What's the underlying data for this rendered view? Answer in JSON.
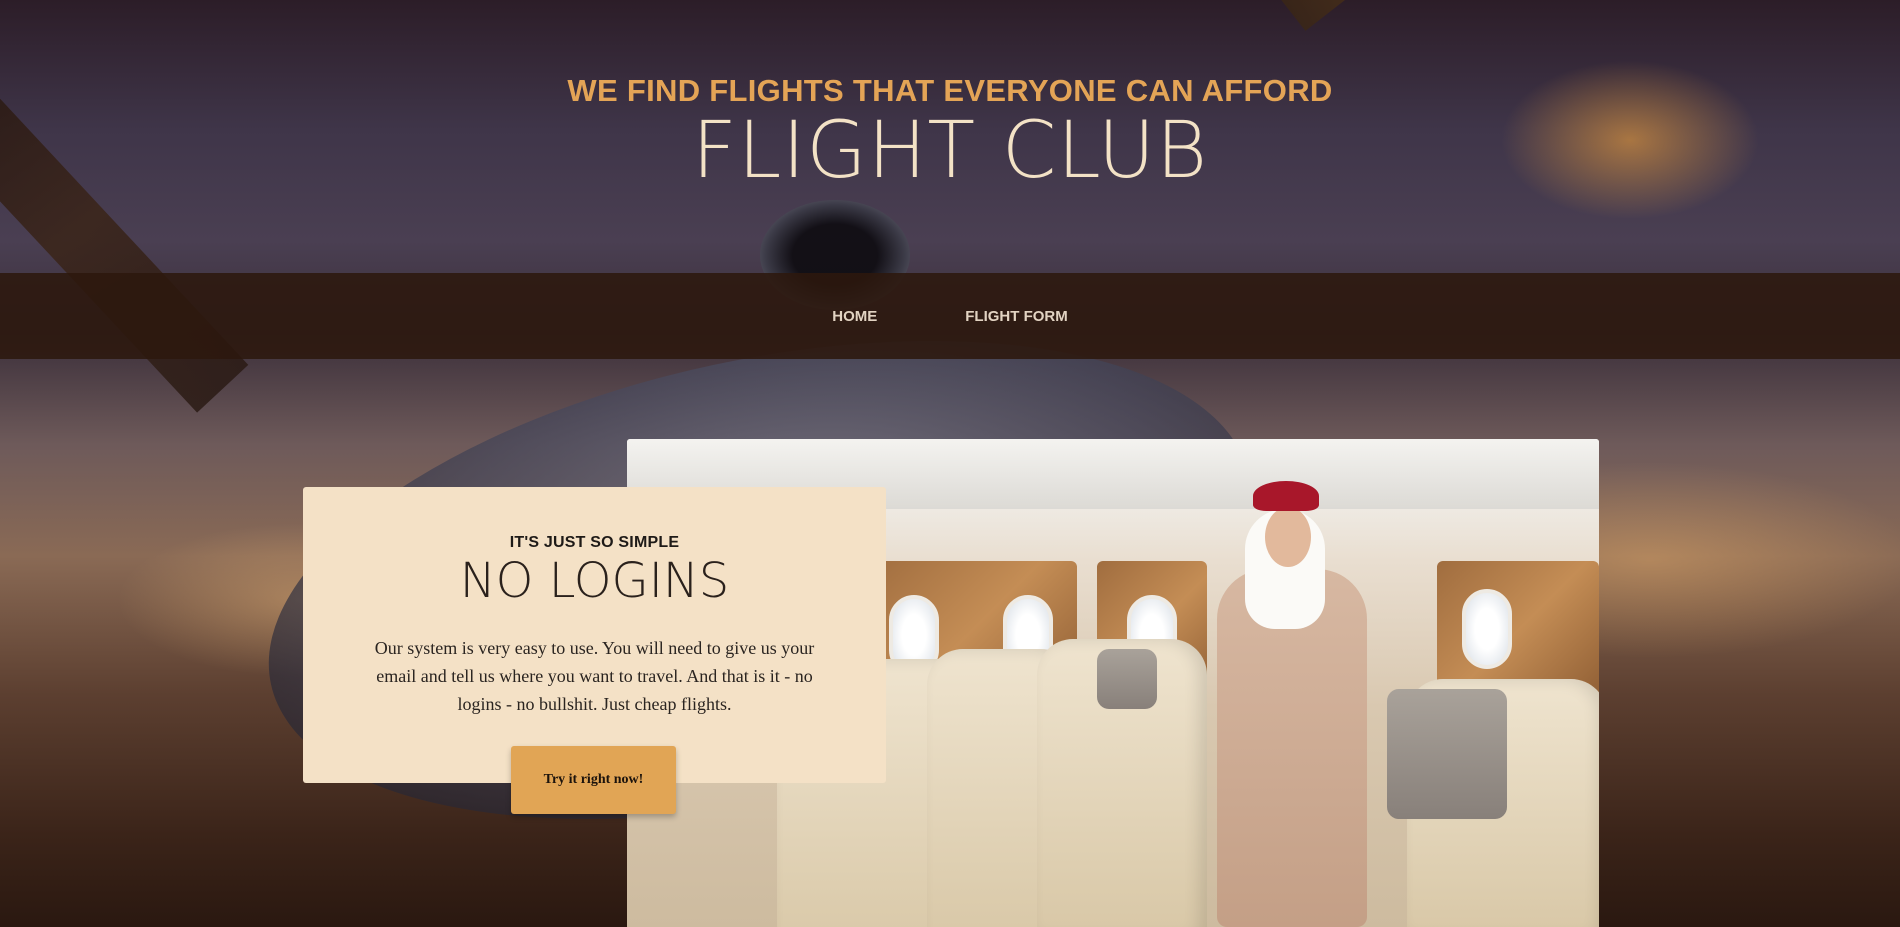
{
  "header": {
    "tagline": "WE FIND FLIGHTS THAT EVERYONE CAN AFFORD",
    "title": "FLIGHT CLUB"
  },
  "nav": {
    "items": [
      {
        "label": "HOME"
      },
      {
        "label": "FLIGHT FORM"
      }
    ]
  },
  "feature": {
    "eyebrow": "IT'S JUST SO SIMPLE",
    "heading": "NO LOGINS",
    "body": "Our system is very easy to use. You will need to give us your email and tell us where you want to travel. And that is it - no logins - no bullshit. Just cheap flights.",
    "cta_label": "Try it right now!"
  },
  "colors": {
    "accent": "#e1a555",
    "tagline": "#e4a456",
    "card_background": "#f4e1c6",
    "navbar": "#2c180e"
  }
}
